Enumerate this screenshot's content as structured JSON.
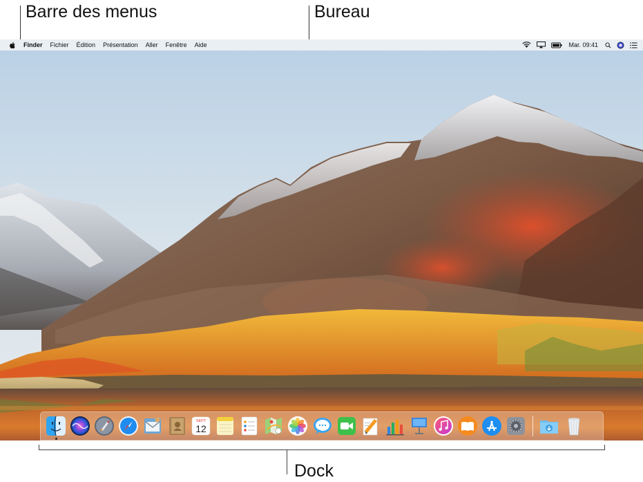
{
  "callouts": {
    "menubar_label": "Barre des menus",
    "desktop_label": "Bureau",
    "dock_label": "Dock"
  },
  "menubar": {
    "apple_icon": "apple-icon",
    "items": [
      "Finder",
      "Fichier",
      "Édition",
      "Présentation",
      "Aller",
      "Fenêtre",
      "Aide"
    ],
    "status_icons": [
      "wifi-icon",
      "airplay-icon",
      "battery-icon"
    ],
    "clock": "Mar. 09:41",
    "right_icons": [
      "spotlight-search-icon",
      "siri-icon",
      "notification-center-icon"
    ]
  },
  "dock": {
    "calendar_month": "SEPT",
    "calendar_day": "12",
    "apps": [
      {
        "name": "finder-icon",
        "running": true
      },
      {
        "name": "siri-icon",
        "running": false
      },
      {
        "name": "launchpad-icon",
        "running": false
      },
      {
        "name": "safari-icon",
        "running": false
      },
      {
        "name": "mail-icon",
        "running": false
      },
      {
        "name": "contacts-icon",
        "running": false
      },
      {
        "name": "calendar-icon",
        "running": false
      },
      {
        "name": "notes-icon",
        "running": false
      },
      {
        "name": "reminders-icon",
        "running": false
      },
      {
        "name": "maps-icon",
        "running": false
      },
      {
        "name": "photos-icon",
        "running": false
      },
      {
        "name": "messages-icon",
        "running": false
      },
      {
        "name": "facetime-icon",
        "running": false
      },
      {
        "name": "pages-icon",
        "running": false
      },
      {
        "name": "numbers-icon",
        "running": false
      },
      {
        "name": "keynote-icon",
        "running": false
      },
      {
        "name": "itunes-icon",
        "running": false
      },
      {
        "name": "ibooks-icon",
        "running": false
      },
      {
        "name": "app-store-icon",
        "running": false
      },
      {
        "name": "system-preferences-icon",
        "running": false
      }
    ],
    "right": [
      "downloads-folder-icon",
      "trash-icon"
    ]
  },
  "colors": {
    "sky": "#c5d6e4",
    "autumn_orange": "#e0612a",
    "foliage_yellow": "#e3a52a"
  }
}
